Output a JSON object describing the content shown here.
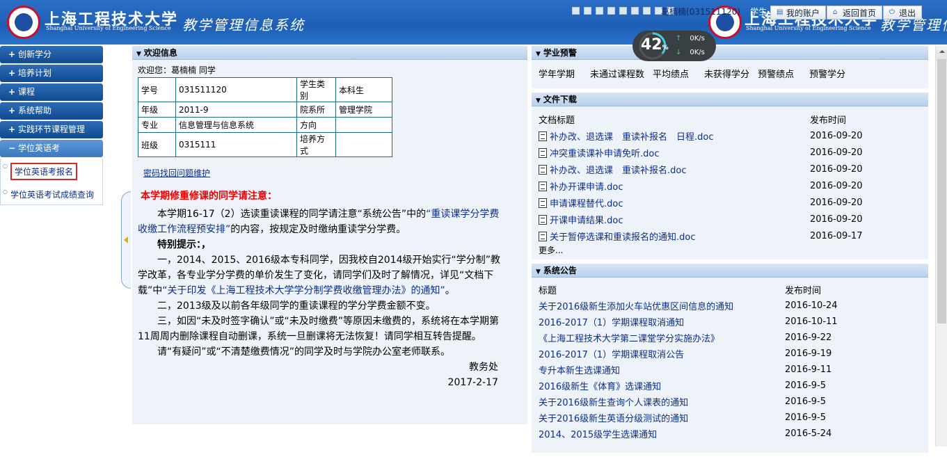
{
  "header": {
    "school_cn": "上海工程技术大学",
    "school_en": "Shanghai University of Engineering Science",
    "system_title": "教学管理信息系统",
    "user": "葛楠楠(031511120)",
    "user_trailing": "学生",
    "buttons": [
      {
        "label": "我的账户",
        "icon": "account-icon"
      },
      {
        "label": "返回首页",
        "icon": "home-icon"
      },
      {
        "label": "退出",
        "icon": "power-icon"
      }
    ]
  },
  "speed_widget": {
    "percent": "42",
    "percent_unit": "%",
    "up": "0K/s",
    "down": "0K/s"
  },
  "sidebar": {
    "items": [
      {
        "label": "创新学分",
        "symbol": "+"
      },
      {
        "label": "培养计划",
        "symbol": "+"
      },
      {
        "label": "课程",
        "symbol": "+"
      },
      {
        "label": "系统帮助",
        "symbol": "+"
      },
      {
        "label": "实践环节课程管理",
        "symbol": "+"
      },
      {
        "label": "学位英语考",
        "symbol": "−"
      }
    ],
    "subitems": [
      {
        "label": "学位英语考报名"
      },
      {
        "label": "学位英语考试成绩查询"
      }
    ]
  },
  "welcome": {
    "title": "欢迎信息",
    "hello": "欢迎您：葛楠楠 同学",
    "table": [
      [
        "学号",
        "031511120",
        "学生类别",
        "本科生"
      ],
      [
        "年级",
        "2011-9",
        "院系所",
        "管理学院"
      ],
      [
        "专业",
        "信息管理与信息系统",
        "方向",
        ""
      ],
      [
        "班级",
        "0315111",
        "培养方式",
        ""
      ]
    ],
    "pwd_link": "密码找回问题维护",
    "notice_title": "本学期修重修课的同学请注意：",
    "p1a": "本学期16-17（2）选读重读课程的同学请注意“系统公告”中的",
    "p1link": "“重读课学分学费收缴工作流程预安排”",
    "p1b": "的内容，按规定及时缴纳重读学分学费。",
    "p2": "特别提示：，",
    "p3a": "一，2014、2015、2016级本专科同学，因我校自2014级开始实行“学分制”教学改革，各专业学分学费的单价发生了变化，请同学们及时了解情况，详见“文档下载”中",
    "p3link": "“关于印发《上海工程技术大学学分制学费收缴管理办法》的通知”",
    "p3b": "。",
    "p4": "二，2013级及以前各年级同学的重读课程的学分学费金额不变。",
    "p5": "三，如因“未及时签字确认”或“未及时缴费”等原因未缴费的，系统将在本学期第11周周内删除课程自动删课，系统一旦删课将无法恢复！请同学相互转告提醒。",
    "p6": "请“有疑问”或“不清楚缴费情况”的同学及时与学院办公室老师联系。",
    "sign1": "教务处",
    "sign2": "2017-2-17"
  },
  "alert": {
    "title": "学业预警",
    "columns": [
      "学年学期",
      "未通过课程数",
      "平均绩点",
      "未获得学分",
      "预警绩点",
      "预警学分"
    ]
  },
  "files": {
    "title": "文件下载",
    "col_title": "文档标题",
    "col_date": "发布时间",
    "rows": [
      {
        "title": "补办改、退选课　重读补报名　日程.doc",
        "date": "2016-09-20"
      },
      {
        "title": "冲突重读课补申请免听.doc",
        "date": "2016-09-20"
      },
      {
        "title": "补办改、退选课　重读补报名.doc",
        "date": "2016-09-20"
      },
      {
        "title": "补办开课申请.doc",
        "date": "2016-09-20"
      },
      {
        "title": "申请课程替代.doc",
        "date": "2016-09-20"
      },
      {
        "title": "开课申请结果.doc",
        "date": "2016-09-20"
      },
      {
        "title": "关于暂停选课和重读报名的通知.doc",
        "date": "2016-09-17"
      }
    ],
    "more": "更多..."
  },
  "announcements": {
    "title": "系统公告",
    "col_title": "标题",
    "col_date": "发布时间",
    "rows": [
      {
        "title": "关于2016级新生添加火车站优惠区间信息的通知",
        "date": "2016-10-24"
      },
      {
        "title": "2016-2017（1）学期课程取消通知",
        "date": "2016-10-11"
      },
      {
        "title": "《上海工程技术大学第二课堂学分实施办法》",
        "date": "2016-9-22"
      },
      {
        "title": "2016-2017（1）学期课程取消公告",
        "date": "2016-9-19"
      },
      {
        "title": "专升本新生选课通知",
        "date": "2016-9-11"
      },
      {
        "title": "2016级新生《体育》选课通知",
        "date": "2016-9-5"
      },
      {
        "title": "关于2016级新生查询个人课表的通知",
        "date": "2016-9-5"
      },
      {
        "title": "关于2016级新生英语分级测试的通知",
        "date": "2016-9-5"
      },
      {
        "title": "2014、2015级学生选课通知",
        "date": "2016-5-24"
      }
    ]
  }
}
